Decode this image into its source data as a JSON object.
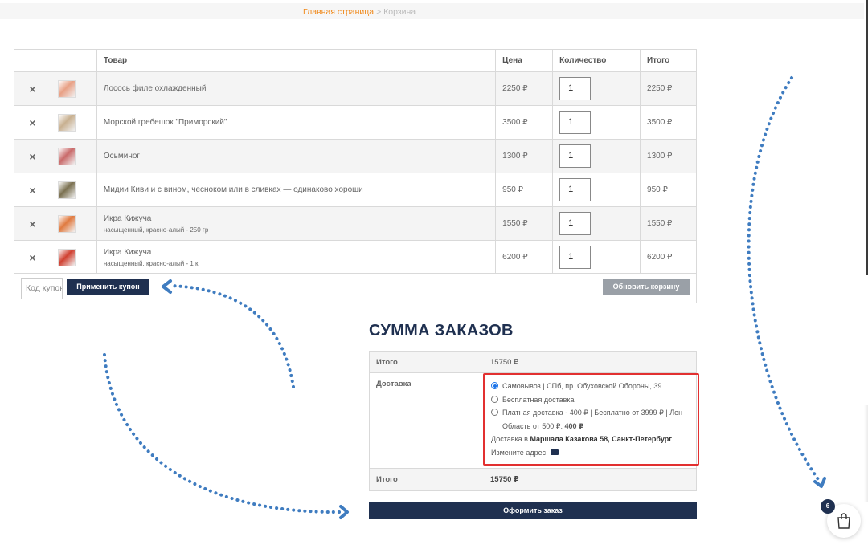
{
  "breadcrumb": {
    "home": "Главная страница",
    "sep": ">",
    "current": "Корзина"
  },
  "cart": {
    "columns": [
      "",
      "",
      "Товар",
      "Цена",
      "Количество",
      "Итого"
    ],
    "rows": [
      {
        "name": "Лосось филе охлажденный",
        "sub": "",
        "price": "2250 ₽",
        "qty": "1",
        "total": "2250 ₽",
        "thumb_color": "#e8a085"
      },
      {
        "name": "Морской гребешок \"Приморский\"",
        "sub": "",
        "price": "3500 ₽",
        "qty": "1",
        "total": "3500 ₽",
        "thumb_color": "#c8b090"
      },
      {
        "name": "Осьминог",
        "sub": "",
        "price": "1300 ₽",
        "qty": "1",
        "total": "1300 ₽",
        "thumb_color": "#c96a6a"
      },
      {
        "name": "Мидии Киви и с вином, чесноком или в сливках — одинаково хороши",
        "sub": "",
        "price": "950 ₽",
        "qty": "1",
        "total": "950 ₽",
        "thumb_color": "#7a7050"
      },
      {
        "name": "Икра Кижуча",
        "sub": "насыщенный, красно-алый - 250 гр",
        "price": "1550 ₽",
        "qty": "1",
        "total": "1550 ₽",
        "thumb_color": "#e07a40"
      },
      {
        "name": "Икра Кижуча",
        "sub": "насыщенный, красно-алый - 1 кг",
        "price": "6200 ₽",
        "qty": "1",
        "total": "6200 ₽",
        "thumb_color": "#d04030"
      }
    ],
    "remove_icon": "×"
  },
  "coupon": {
    "placeholder": "Код купона",
    "apply_label": "Применить купон",
    "update_label": "Обновить корзину"
  },
  "totals": {
    "title": "СУММА ЗАКАЗОВ",
    "subtotal_label": "Итого",
    "subtotal_value": "15750 ₽",
    "shipping_label": "Доставка",
    "options": [
      {
        "label": "Самовывоз | СПб, пр. Обуховской Обороны, 39",
        "selected": true
      },
      {
        "label": "Бесплатная доставка",
        "selected": false
      },
      {
        "label": "Платная доставка - 400 ₽ | Бесплатно от 3999 ₽ | Лен Область от 500 ₽: ",
        "price": "400 ₽",
        "selected": false
      }
    ],
    "address_prefix": "Доставка в ",
    "address": "Маршала Казакова 58, Санкт-Петербург",
    "address_suffix": ".",
    "change_address": "Измените адрес",
    "total_label": "Итого",
    "total_value": "15750 ₽",
    "checkout_label": "Оформить заказ"
  },
  "floating_cart": {
    "count": "6",
    "icon": "shopping-bag-icon"
  },
  "colors": {
    "navy": "#1f3050",
    "accent": "#f08a1c",
    "remove": "#e00000",
    "highlight": "#e23030",
    "arrow": "#3f7cc0"
  }
}
